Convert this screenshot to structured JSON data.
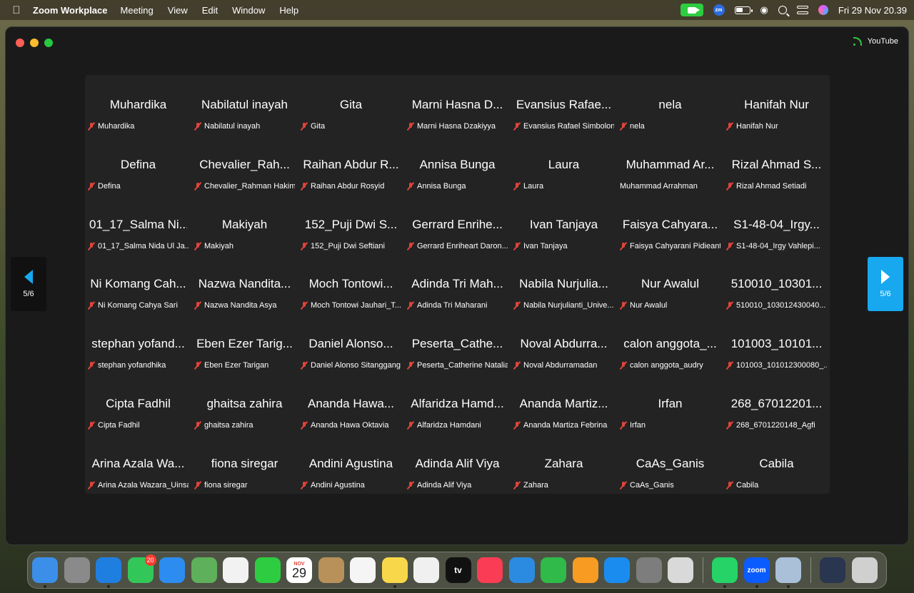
{
  "menubar": {
    "app_name": "Zoom Workplace",
    "menus": [
      "Meeting",
      "View",
      "Edit",
      "Window",
      "Help"
    ],
    "zoom_status": "zm",
    "clock": "Fri 29 Nov  20.39"
  },
  "window": {
    "stream_label": "YouTube"
  },
  "pager": {
    "left_label": "5/6",
    "right_label": "5/6"
  },
  "participants": [
    {
      "big": "Muhardika",
      "small": "Muhardika",
      "muted": true
    },
    {
      "big": "Nabilatul inayah",
      "small": "Nabilatul inayah",
      "muted": true
    },
    {
      "big": "Gita",
      "small": "Gita",
      "muted": true
    },
    {
      "big": "Marni Hasna D...",
      "small": "Marni Hasna Dzakiyya",
      "muted": true
    },
    {
      "big": "Evansius Rafae...",
      "small": "Evansius Rafael Simbolon",
      "muted": true
    },
    {
      "big": "nela",
      "small": "nela",
      "muted": true
    },
    {
      "big": "Hanifah Nur",
      "small": "Hanifah Nur",
      "muted": true
    },
    {
      "big": "Defina",
      "small": "Defina",
      "muted": true
    },
    {
      "big": "Chevalier_Rah...",
      "small": "Chevalier_Rahman Hakim",
      "muted": true
    },
    {
      "big": "Raihan Abdur R...",
      "small": "Raihan Abdur Rosyid",
      "muted": true
    },
    {
      "big": "Annisa Bunga",
      "small": "Annisa Bunga",
      "muted": true
    },
    {
      "big": "Laura",
      "small": "Laura",
      "muted": true
    },
    {
      "big": "Muhammad Ar...",
      "small": "Muhammad Arrahman",
      "muted": false
    },
    {
      "big": "Rizal Ahmad S...",
      "small": "Rizal Ahmad Setiadi",
      "muted": true
    },
    {
      "big": "01_17_Salma Ni...",
      "small": "01_17_Salma Nida Ul Ja...",
      "muted": true
    },
    {
      "big": "Makiyah",
      "small": "Makiyah",
      "muted": true
    },
    {
      "big": "152_Puji Dwi S...",
      "small": "152_Puji Dwi Seftiani",
      "muted": true
    },
    {
      "big": "Gerrard Enrihe...",
      "small": "Gerrard Enriheart Daron...",
      "muted": true
    },
    {
      "big": "Ivan Tanjaya",
      "small": "Ivan Tanjaya",
      "muted": true
    },
    {
      "big": "Faisya Cahyara...",
      "small": "Faisya Cahyarani Pidieanti",
      "muted": true
    },
    {
      "big": "S1-48-04_Irgy...",
      "small": "S1-48-04_Irgy Vahlepi...",
      "muted": true
    },
    {
      "big": "Ni Komang Cah...",
      "small": "Ni Komang Cahya Sari",
      "muted": true
    },
    {
      "big": "Nazwa Nandita...",
      "small": "Nazwa Nandita Asya",
      "muted": true
    },
    {
      "big": "Moch Tontowi...",
      "small": "Moch Tontowi Jauhari_T...",
      "muted": true
    },
    {
      "big": "Adinda Tri Mah...",
      "small": "Adinda Tri Maharani",
      "muted": true
    },
    {
      "big": "Nabila Nurjulia...",
      "small": "Nabila Nurjulianti_Unive...",
      "muted": true
    },
    {
      "big": "Nur Awalul",
      "small": "Nur Awalul",
      "muted": true
    },
    {
      "big": "510010_10301...",
      "small": "510010_103012430040...",
      "muted": true
    },
    {
      "big": "stephan yofand...",
      "small": "stephan yofandhika",
      "muted": true
    },
    {
      "big": "Eben Ezer Tarig...",
      "small": "Eben Ezer Tarigan",
      "muted": true
    },
    {
      "big": "Daniel Alonso...",
      "small": "Daniel Alonso Sitanggang",
      "muted": true
    },
    {
      "big": "Peserta_Cathe...",
      "small": "Peserta_Catherine Natalia",
      "muted": true
    },
    {
      "big": "Noval Abdurra...",
      "small": "Noval Abdurramadan",
      "muted": true
    },
    {
      "big": "calon anggota_...",
      "small": "calon anggota_audry",
      "muted": true
    },
    {
      "big": "101003_10101...",
      "small": "101003_101012300080_...",
      "muted": true
    },
    {
      "big": "Cipta Fadhil",
      "small": "Cipta Fadhil",
      "muted": true
    },
    {
      "big": "ghaitsa zahira",
      "small": "ghaitsa zahira",
      "muted": true
    },
    {
      "big": "Ananda Hawa...",
      "small": "Ananda Hawa Oktavia",
      "muted": true
    },
    {
      "big": "Alfaridza Hamd...",
      "small": "Alfaridza Hamdani",
      "muted": true
    },
    {
      "big": "Ananda Martiz...",
      "small": "Ananda Martiza Febrina",
      "muted": true
    },
    {
      "big": "Irfan",
      "small": "Irfan",
      "muted": true
    },
    {
      "big": "268_67012201...",
      "small": "268_6701220148_Agfi",
      "muted": true
    },
    {
      "big": "Arina Azala Wa...",
      "small": "Arina Azala Wazara_Uinsa",
      "muted": true
    },
    {
      "big": "fiona siregar",
      "small": "fiona siregar",
      "muted": true
    },
    {
      "big": "Andini Agustina",
      "small": "Andini Agustina",
      "muted": true
    },
    {
      "big": "Adinda Alif Viya",
      "small": "Adinda Alif Viya",
      "muted": true
    },
    {
      "big": "Zahara",
      "small": "Zahara",
      "muted": true
    },
    {
      "big": "CaAs_Ganis",
      "small": "CaAs_Ganis",
      "muted": true
    },
    {
      "big": "Cabila",
      "small": "Cabila",
      "muted": true
    }
  ],
  "dock": {
    "messages_badge": "20",
    "calendar_month": "NOV",
    "calendar_day": "29",
    "tv_label": "tv",
    "zoom_label": "zoom",
    "items": [
      {
        "name": "finder-icon",
        "color": "#3b8fe8",
        "dot": true
      },
      {
        "name": "launchpad-icon",
        "color": "#8a8a8a",
        "dot": false
      },
      {
        "name": "safari-icon",
        "color": "#1f7fe0",
        "dot": true
      },
      {
        "name": "messages-icon",
        "color": "#33c759",
        "dot": false,
        "badge": true
      },
      {
        "name": "mail-icon",
        "color": "#2d8cf0",
        "dot": false
      },
      {
        "name": "maps-icon",
        "color": "#5fb05a",
        "dot": false
      },
      {
        "name": "photos-icon",
        "color": "#f2f2f2",
        "dot": false
      },
      {
        "name": "facetime-icon",
        "color": "#2ecc40",
        "dot": false
      },
      {
        "name": "calendar-icon",
        "color": "#ffffff",
        "dot": false,
        "calendar": true
      },
      {
        "name": "contacts-icon",
        "color": "#b8915a",
        "dot": false
      },
      {
        "name": "reminders-icon",
        "color": "#f5f5f5",
        "dot": false
      },
      {
        "name": "notes-icon",
        "color": "#f8d84a",
        "dot": true
      },
      {
        "name": "freeform-icon",
        "color": "#f0f0f0",
        "dot": false
      },
      {
        "name": "apple-tv-icon",
        "color": "#111111",
        "dot": false,
        "tv": true
      },
      {
        "name": "music-icon",
        "color": "#fa3c55",
        "dot": false
      },
      {
        "name": "keynote-icon",
        "color": "#2b8be0",
        "dot": false
      },
      {
        "name": "numbers-icon",
        "color": "#2fba4a",
        "dot": false
      },
      {
        "name": "pages-icon",
        "color": "#f79b22",
        "dot": false
      },
      {
        "name": "app-store-icon",
        "color": "#1a8cf0",
        "dot": false
      },
      {
        "name": "system-settings-icon",
        "color": "#7d7d7d",
        "dot": false
      },
      {
        "name": "iphone-mirroring-icon",
        "color": "#d9d9d9",
        "dot": false
      },
      {
        "sep": true
      },
      {
        "name": "whatsapp-icon",
        "color": "#25d366",
        "dot": true
      },
      {
        "name": "zoom-icon",
        "color": "#0b5cff",
        "dot": true,
        "zoom": true
      },
      {
        "name": "preview-icon",
        "color": "#a9c0d8",
        "dot": true
      },
      {
        "sep": true
      },
      {
        "name": "downloads-folder-icon",
        "color": "#2a3550",
        "dot": false
      },
      {
        "name": "trash-icon",
        "color": "#d0d0d0",
        "dot": false
      }
    ]
  }
}
